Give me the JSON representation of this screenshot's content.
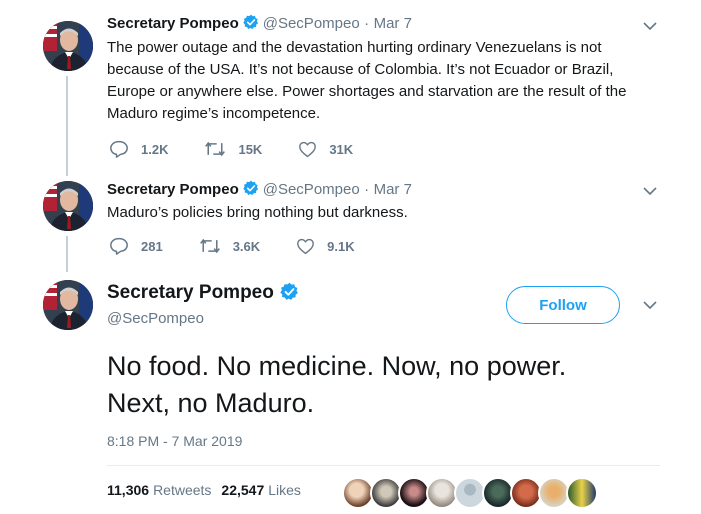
{
  "tweets": [
    {
      "name": "Secretary Pompeo",
      "handle": "@SecPompeo",
      "separator": "·",
      "date": "Mar 7",
      "text": "The power outage and the devastation hurting ordinary Venezuelans is not because of the USA. It’s not because of Colombia.  It’s not Ecuador or Brazil, Europe or anywhere else. Power shortages and starvation are the result of the Maduro regime’s incompetence.",
      "replies": "1.2K",
      "retweets": "15K",
      "likes": "31K"
    },
    {
      "name": "Secretary Pompeo",
      "handle": "@SecPompeo",
      "separator": "·",
      "date": "Mar 7",
      "text": "Maduro’s policies bring nothing but darkness.",
      "replies": "281",
      "retweets": "3.6K",
      "likes": "9.1K"
    }
  ],
  "main": {
    "name": "Secretary Pompeo",
    "handle": "@SecPompeo",
    "follow_label": "Follow",
    "text_line1": "No food. No medicine. Now, no power.",
    "text_line2": "Next, no Maduro.",
    "timestamp": "8:18 PM - 7 Mar 2019",
    "retweet_count": "11,306",
    "retweet_label": "Retweets",
    "like_count": "22,547",
    "like_label": "Likes"
  },
  "icons": {
    "verified": "verified-badge-icon",
    "reply": "reply-icon",
    "retweet": "retweet-icon",
    "like": "heart-icon",
    "chevron": "chevron-down-icon"
  },
  "colors": {
    "accent": "#1da1f2",
    "text": "#14171a",
    "muted": "#657786",
    "thread_line": "#c4cfd6"
  }
}
